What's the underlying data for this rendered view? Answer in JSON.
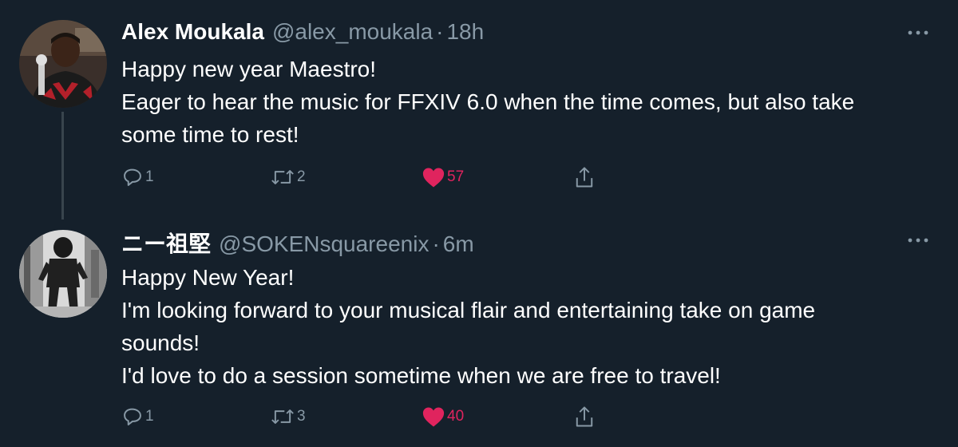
{
  "tweets": [
    {
      "display_name": "Alex Moukala",
      "handle": "@alex_moukala",
      "separator": "·",
      "time": "18h",
      "body_lines": [
        "Happy new year Maestro!",
        "Eager to hear the music for FFXIV 6.0 when the time comes, but also take",
        "some time to rest!"
      ],
      "replies": "1",
      "retweets": "2",
      "likes": "57",
      "liked": true
    },
    {
      "display_name": "ニー祖堅",
      "handle": "@SOKENsquareenix",
      "separator": "·",
      "time": "6m",
      "body_lines": [
        "Happy New Year!",
        "I'm looking forward to your musical flair and entertaining take on game",
        "sounds!",
        "I'd love to do a session sometime when we are free to travel!"
      ],
      "replies": "1",
      "retweets": "3",
      "likes": "40",
      "liked": true
    }
  ],
  "icons": {
    "reply": "reply-icon",
    "retweet": "retweet-icon",
    "like": "heart-icon",
    "share": "share-icon",
    "more": "more-icon"
  },
  "colors": {
    "background": "#15202b",
    "secondary_text": "#8899a6",
    "like": "#e0245e",
    "thread_line": "#38444d"
  }
}
